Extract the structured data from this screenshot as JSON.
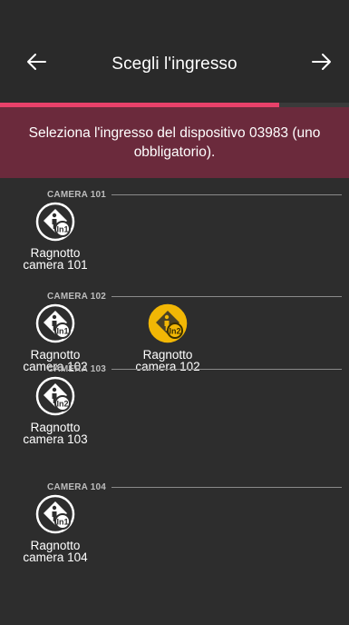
{
  "header": {
    "title": "Scegli l'ingresso",
    "progress_fraction": 0.8,
    "accent": "#e8416a"
  },
  "banner": {
    "text": "Seleziona l'ingresso del dispositivo 03983 (uno obbligatorio)."
  },
  "sections": [
    {
      "label": "CAMERA 101",
      "items": [
        {
          "line1": "Ragnotto",
          "line2": "camera 101",
          "badge": "In1",
          "selected": false
        }
      ]
    },
    {
      "label": "CAMERA 102",
      "items": [
        {
          "line1": "Ragnotto",
          "line2": "camera 102",
          "badge": "In1",
          "selected": false
        },
        {
          "line1": "Ragnotto",
          "line2": "camera 102",
          "badge": "In2",
          "selected": true
        }
      ]
    },
    {
      "label": "CAMERA 103",
      "items": [
        {
          "line1": "Ragnotto",
          "line2": "camera 103",
          "badge": "In2",
          "selected": false
        }
      ]
    },
    {
      "label": "CAMERA 104",
      "items": [
        {
          "line1": "Ragnotto",
          "line2": "camera 104",
          "badge": "In1",
          "selected": false
        }
      ]
    }
  ],
  "icons": {
    "back": "arrow-left-icon",
    "next": "arrow-right-icon",
    "sensor": "person-sensor-icon"
  },
  "colors": {
    "selected": "#f2b705",
    "unselected": "#ffffff",
    "banner": "#6b2a3c"
  }
}
